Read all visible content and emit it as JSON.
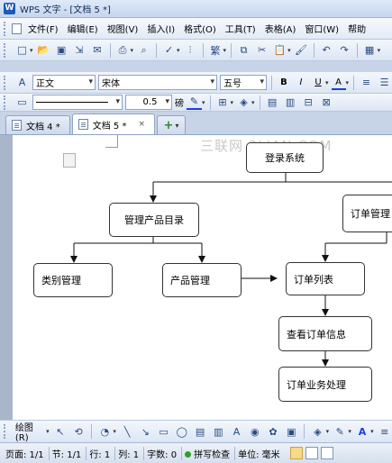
{
  "window": {
    "title": "WPS 文字 - [文档 5 *]",
    "app_icon": "W"
  },
  "menu": [
    "文件(F)",
    "编辑(E)",
    "视图(V)",
    "插入(I)",
    "格式(O)",
    "工具(T)",
    "表格(A)",
    "窗口(W)",
    "帮助"
  ],
  "format_toolbar": {
    "style": "正文",
    "font": "宋体",
    "size": "五号",
    "bold": "B",
    "italic": "I",
    "underline": "U",
    "font_color_letter": "A"
  },
  "draw_toolbar2": {
    "line_width": "0.5",
    "line_unit": "磅"
  },
  "tabs": [
    {
      "label": "文档 4 *"
    },
    {
      "label": "文档 5 *",
      "active": true,
      "close": "×"
    }
  ],
  "tab_add": "+",
  "document": {
    "watermark": "三联网 3LIAN.COM",
    "flowchart": {
      "login": "登录系统",
      "manage_catalog": "管理产品目录",
      "order_manage": "订单管理",
      "category_manage": "类别管理",
      "product_manage": "产品管理",
      "order_list": "订单列表",
      "view_order": "查看订单信息",
      "order_process": "订单业务处理"
    }
  },
  "drawing_bar": {
    "label": "绘图(R)"
  },
  "status": {
    "page": "页面: 1/1",
    "section": "节: 1/1",
    "row": "行: 1",
    "col": "列: 1",
    "chars": "字数: 0",
    "spell": "拼写检查",
    "unit": "单位: 毫米"
  },
  "colors": {
    "accent": "#1d5bb8",
    "chrome": "#c7d3e6",
    "font_color": "#1a3fd6"
  }
}
